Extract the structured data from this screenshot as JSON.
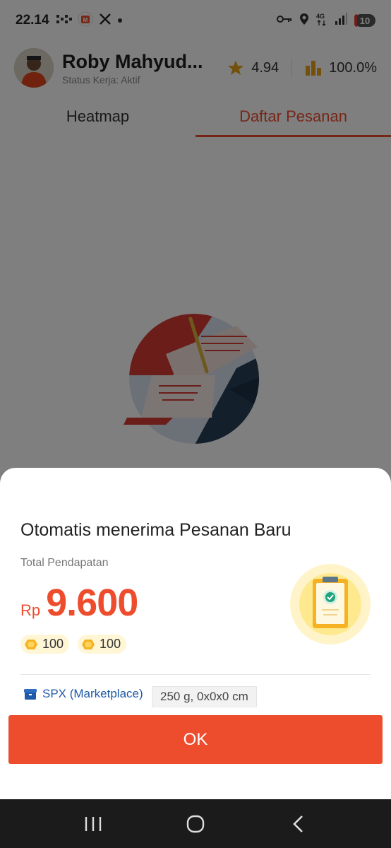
{
  "status_bar": {
    "time": "22.14",
    "icons_left": [
      "dots-grid-icon",
      "shopee-icon",
      "x-app-icon",
      "dot-icon"
    ],
    "icons_right": [
      "key-icon",
      "location-icon",
      "4g-icon",
      "signal-icon"
    ],
    "battery": "10"
  },
  "header": {
    "name": "Roby Mahyud...",
    "status": "Status Kerja: Aktif",
    "rating": "4.94",
    "acceptance_rate": "100.0%"
  },
  "tabs": [
    {
      "label": "Heatmap",
      "active": false
    },
    {
      "label": "Daftar Pesanan",
      "active": true
    }
  ],
  "sheet": {
    "title": "Otomatis menerima Pesanan Baru",
    "income_label": "Total Pendapatan",
    "currency": "Rp",
    "amount": "9.600",
    "coins": [
      "100",
      "100"
    ],
    "service": "SPX (Marketplace)",
    "dimensions": "250 g, 0x0x0 cm",
    "ok_label": "OK"
  },
  "colors": {
    "accent": "#ee4d2d",
    "link": "#1f5aa6",
    "coin": "#f5b223"
  }
}
